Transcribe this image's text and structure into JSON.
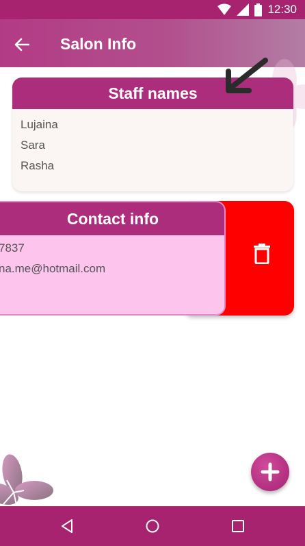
{
  "status_bar": {
    "time": "12:30",
    "icons": [
      "wifi-icon",
      "signal-icon",
      "battery-icon"
    ]
  },
  "app_bar": {
    "title": "Salon Info",
    "back_icon": "arrow-left-icon"
  },
  "staff_card": {
    "title": "Staff names",
    "names": [
      "Lujaina",
      "Sara",
      "Rasha"
    ]
  },
  "contact_card": {
    "title": "Contact info",
    "phone": "7837",
    "email": "na.me@hotmail.com"
  },
  "swipe_action": {
    "icon": "trash-icon",
    "color": "#ff0000"
  },
  "fab": {
    "icon": "plus-icon"
  },
  "nav_bar": {
    "icons": [
      "back-triangle-icon",
      "home-circle-icon",
      "recents-square-icon"
    ]
  },
  "colors": {
    "primary": "#a7236f",
    "card_header": "#ac2d7b",
    "contact_bg": "#fdc5ee",
    "staff_bg": "#fbf5f3",
    "delete_red": "#ff0000"
  }
}
